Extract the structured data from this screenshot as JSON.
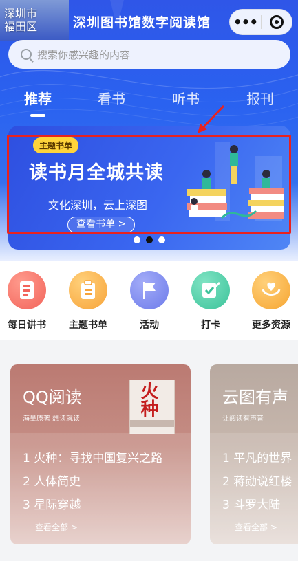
{
  "status": {
    "city_line1": "深圳市",
    "city_line2": "福田区"
  },
  "header": {
    "title": "深圳图书馆数字阅读馆",
    "more_icon": "more-dots-icon",
    "close_icon": "close-target-icon"
  },
  "search": {
    "placeholder": "搜索你感兴趣的内容"
  },
  "tabs": [
    {
      "label": "推荐",
      "active": true
    },
    {
      "label": "看书",
      "active": false
    },
    {
      "label": "听书",
      "active": false
    },
    {
      "label": "报刊",
      "active": false
    }
  ],
  "banner": {
    "tag": "主题书单",
    "headline": "读书月全城共读",
    "subline": "文化深圳，云上深图",
    "cta": "查看书单 >",
    "dots": {
      "count": 3,
      "active_index": 1
    }
  },
  "quick_actions": [
    {
      "label": "每日讲书",
      "icon": "book-card-icon",
      "color": "#f2645b"
    },
    {
      "label": "主题书单",
      "icon": "clipboard-icon",
      "color": "#f7a43a"
    },
    {
      "label": "活动",
      "icon": "flag-icon",
      "color": "#6d7bea"
    },
    {
      "label": "打卡",
      "icon": "check-pen-icon",
      "color": "#3cc39a"
    },
    {
      "label": "更多资源",
      "icon": "heart-hand-icon",
      "color": "#f6a531"
    }
  ],
  "cards": [
    {
      "title": "QQ阅读",
      "subtitle": "海量原著 想读就读",
      "items": [
        "1 火种：寻找中国复兴之路",
        "2 人体简史",
        "3 星际穿越"
      ],
      "more": "查看全部 >",
      "book_title": "火种"
    },
    {
      "title": "云图有声",
      "subtitle": "让阅读有声音",
      "items": [
        "1 平凡的世界",
        "2 蒋勋说红楼",
        "3 斗罗大陆"
      ],
      "more": "查看全部 >"
    }
  ],
  "colors": {
    "primary_blue": "#2f56e8",
    "annotation_red": "#e8221f"
  }
}
